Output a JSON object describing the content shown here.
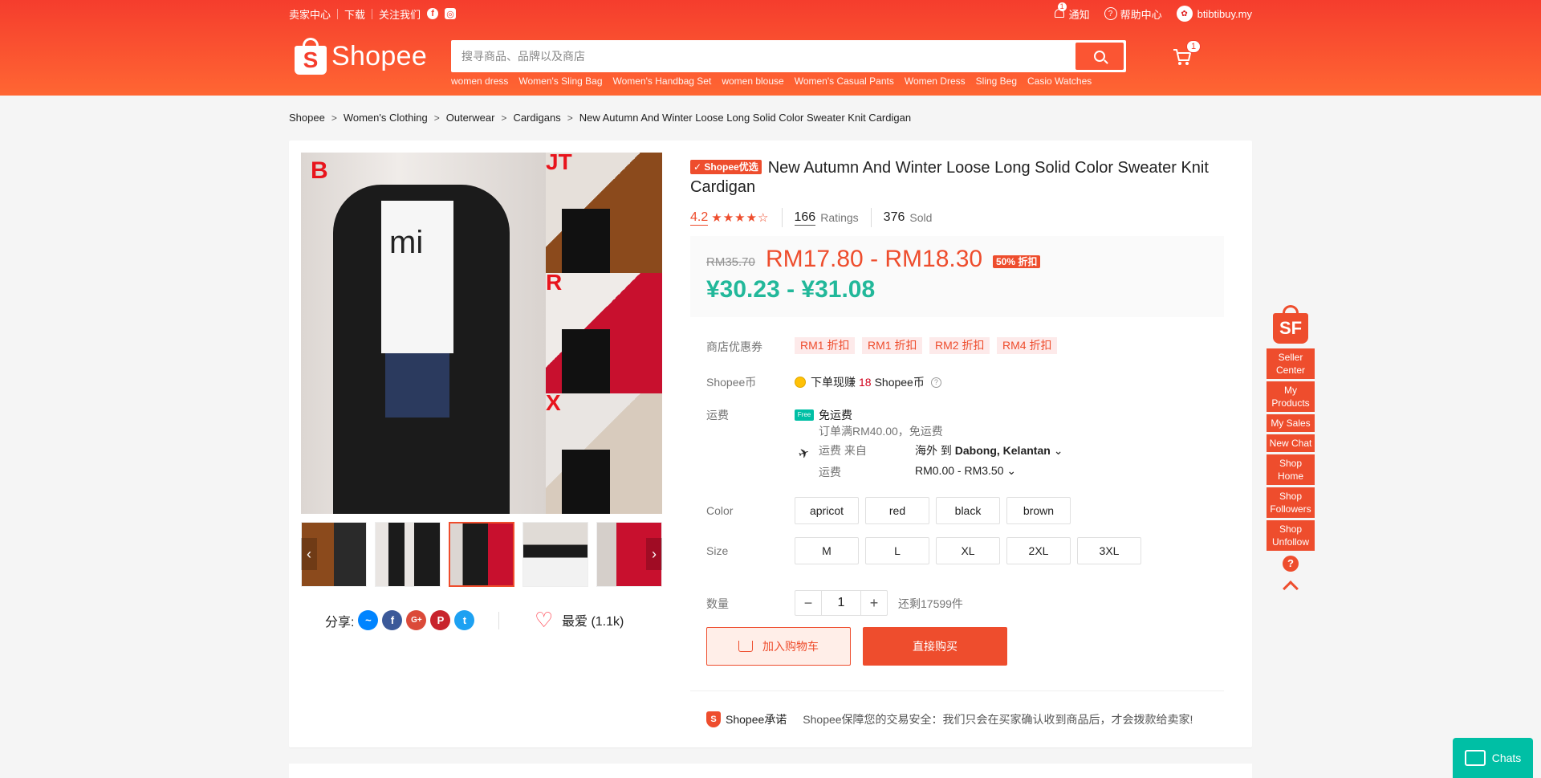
{
  "topbar": {
    "seller_center": "卖家中心",
    "download": "下载",
    "follow_us": "关注我们",
    "notifications": "通知",
    "notification_count": "1",
    "help_center": "帮助中心",
    "username": "btibtibuy.my"
  },
  "header": {
    "logo_text": "Shopee",
    "search_placeholder": "搜寻商品、品牌以及商店",
    "cart_count": "1",
    "hot_searches": [
      "women dress",
      "Women's Sling Bag",
      "Women's Handbag Set",
      "women blouse",
      "Women's Casual Pants",
      "Women Dress",
      "Sling Beg",
      "Casio Watches"
    ]
  },
  "breadcrumb": [
    "Shopee",
    "Women's Clothing",
    "Outerwear",
    "Cardigans",
    "New Autumn And Winter Loose Long Solid Color Sweater Knit Cardigan"
  ],
  "product": {
    "preferred_badge": "Shopee优选",
    "title": "New Autumn And Winter Loose Long Solid Color Sweater Knit Cardigan",
    "rating": "4.2",
    "stars": "★★★★☆",
    "ratings_count": "166",
    "ratings_label": "Ratings",
    "sold_count": "376",
    "sold_label": "Sold",
    "old_price": "RM35.70",
    "price_range": "RM17.80 - RM18.30",
    "discount": "50% 折扣",
    "cny_price": "¥30.23 - ¥31.08",
    "image_labels": {
      "main": "B",
      "t1": "JT",
      "t2": "R",
      "t3": "X",
      "shirt_text": "mi"
    }
  },
  "vouchers": {
    "label": "商店优惠券",
    "items": [
      "RM1 折扣",
      "RM1 折扣",
      "RM2 折扣",
      "RM4 折扣"
    ]
  },
  "coins": {
    "label": "Shopee币",
    "prefix": "下单现赚",
    "amount": "18",
    "suffix": "Shopee币"
  },
  "shipping": {
    "label": "运费",
    "free": "免运费",
    "free_note": "订单满RM40.00，免运费",
    "from_label": "运费 来自",
    "to_prefix": "海外  到",
    "to_location": "Dabong, Kelantan",
    "fee_label": "运费",
    "fee_range": "RM0.00 - RM3.50"
  },
  "color": {
    "label": "Color",
    "options": [
      "apricot",
      "red",
      "black",
      "brown"
    ]
  },
  "size": {
    "label": "Size",
    "options": [
      "M",
      "L",
      "XL",
      "2XL",
      "3XL"
    ]
  },
  "quantity": {
    "label": "数量",
    "value": "1",
    "stock": "还剩17599件"
  },
  "actions": {
    "add_to_cart": "加入购物车",
    "buy_now": "直接购买"
  },
  "share": {
    "label": "分享:",
    "favorite": "最爱 (1.1k)"
  },
  "guarantee": {
    "title": "Shopee承诺",
    "text": "Shopee保障您的交易安全：我们只会在买家确认收到商品后，才会拨款给卖家!"
  },
  "sidebar": {
    "logo": "SF",
    "items": [
      "Seller Center",
      "My Products",
      "My Sales",
      "New Chat",
      "Shop Home",
      "Shop Followers",
      "Shop Unfollow"
    ]
  },
  "chat": {
    "label": "Chats"
  },
  "colors": {
    "brand": "#ee4d2d",
    "cny": "#22b89a",
    "chat": "#00bfa5"
  }
}
